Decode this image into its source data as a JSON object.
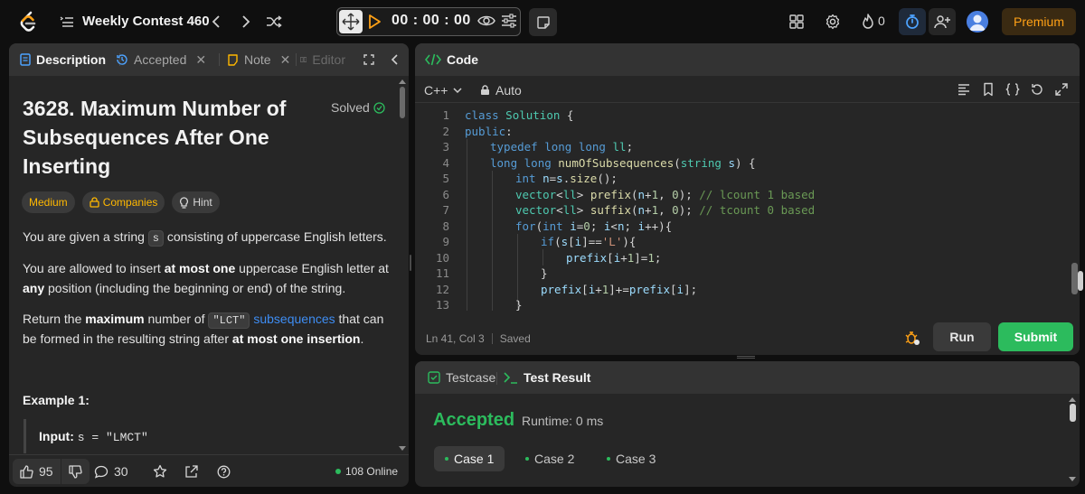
{
  "colors": {
    "accent": "#ffa116",
    "success": "#2cbb5d",
    "link": "#3e8df3",
    "medium": "#ffb800",
    "background": "#0f0f0f",
    "panel": "#262626"
  },
  "topbar": {
    "contest_title": "Weekly Contest 460",
    "timer": "00 : 00 : 00",
    "streak_count": "0",
    "premium_label": "Premium",
    "icons": [
      "leetcode-logo",
      "problem-list-icon",
      "prev-arrow-icon",
      "next-arrow-icon",
      "shuffle-icon",
      "move-icon",
      "play-icon",
      "eye-icon",
      "timer-settings-icon",
      "note-icon",
      "layout-icon",
      "settings-icon",
      "fire-icon",
      "stopwatch-icon",
      "add-user-icon"
    ]
  },
  "left_panel": {
    "tabs": [
      {
        "label": "Description"
      },
      {
        "label": "Accepted"
      },
      {
        "label": "Note"
      },
      {
        "label": "Editor"
      }
    ],
    "problem": {
      "title": "3628. Maximum Number of Subsequences After One Inserting",
      "status": "Solved",
      "tags": {
        "difficulty": "Medium",
        "companies": "Companies",
        "hint": "Hint"
      },
      "p1": {
        "a": "You are given a string ",
        "code": "s",
        "b": " consisting of uppercase English letters."
      },
      "p2": {
        "a": "You are allowed to insert ",
        "bold1": "at most one",
        "b": " uppercase English letter at ",
        "bold2": "any",
        "c": " position (including the beginning or end) of the string."
      },
      "p3": {
        "a": "Return the ",
        "bold1": "maximum",
        "b": " number of ",
        "code": "\"LCT\"",
        "link": "subsequences",
        "c": " that can be formed in the resulting string after ",
        "bold2": "at most one insertion",
        "d": "."
      },
      "example_title": "Example 1:",
      "example_input_label": "Input:",
      "example_input_value": "s = \"LMCT\""
    },
    "footer": {
      "likes": "95",
      "comments": "30",
      "online": "108 Online"
    }
  },
  "code_panel": {
    "title": "Code",
    "language": "C++",
    "mode": "Auto",
    "lines": [
      {
        "n": "1",
        "indent": 0,
        "code": "class Solution {"
      },
      {
        "n": "2",
        "indent": 0,
        "code": "public:"
      },
      {
        "n": "3",
        "indent": 1,
        "code": "typedef long long ll;"
      },
      {
        "n": "4",
        "indent": 1,
        "code": "long long numOfSubsequences(string s) {"
      },
      {
        "n": "5",
        "indent": 2,
        "code": "int n=s.size();"
      },
      {
        "n": "6",
        "indent": 2,
        "code": "vector<ll> prefix(n+1, 0); // lcount 1 based"
      },
      {
        "n": "7",
        "indent": 2,
        "code": "vector<ll> suffix(n+1, 0); // tcount 0 based"
      },
      {
        "n": "8",
        "indent": 2,
        "code": "for(int i=0; i<n; i++){"
      },
      {
        "n": "9",
        "indent": 3,
        "code": "if(s[i]=='L'){"
      },
      {
        "n": "10",
        "indent": 4,
        "code": "prefix[i+1]=1;"
      },
      {
        "n": "11",
        "indent": 3,
        "code": "}"
      },
      {
        "n": "12",
        "indent": 3,
        "code": "prefix[i+1]+=prefix[i];"
      },
      {
        "n": "13",
        "indent": 2,
        "code": "}"
      }
    ],
    "status_position": "Ln 41, Col 3",
    "status_saved": "Saved",
    "run_label": "Run",
    "submit_label": "Submit"
  },
  "test_panel": {
    "tabs": [
      {
        "label": "Testcase"
      },
      {
        "label": "Test Result"
      }
    ],
    "result": "Accepted",
    "runtime": "Runtime: 0 ms",
    "cases": [
      {
        "label": "Case 1"
      },
      {
        "label": "Case 2"
      },
      {
        "label": "Case 3"
      }
    ]
  }
}
